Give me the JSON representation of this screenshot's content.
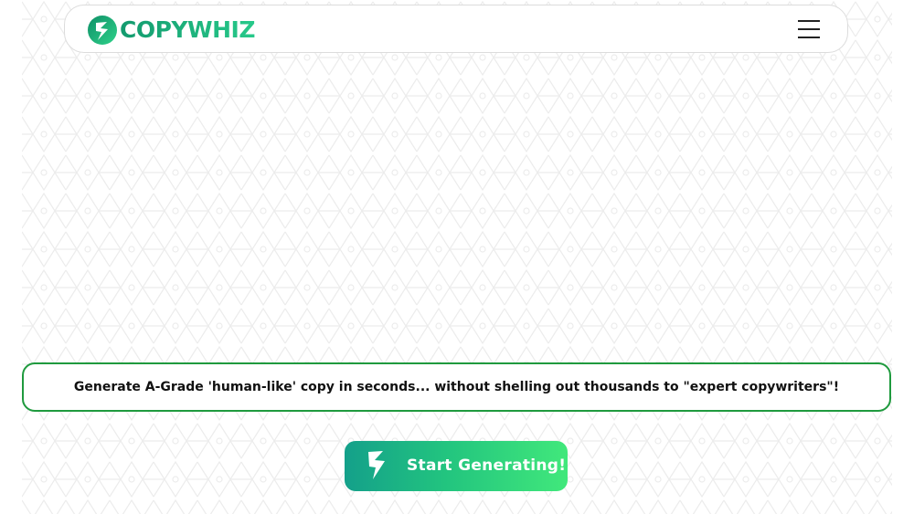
{
  "header": {
    "brand": "COPYWHIZ",
    "logo_icon": "copywhiz-logo-icon",
    "menu_icon": "hamburger-menu-icon"
  },
  "banner": {
    "text": "Generate A-Grade 'human-like' copy in seconds... without shelling out thousands to \"expert copywriters\"!"
  },
  "cta": {
    "label": "Start Generating!",
    "icon": "lightning-icon"
  },
  "colors": {
    "brand_green": "#139a6e",
    "brand_green_light": "#41e87b",
    "banner_border": "#1f9a3e",
    "background": "#ffffff",
    "pattern": "#ececec"
  }
}
